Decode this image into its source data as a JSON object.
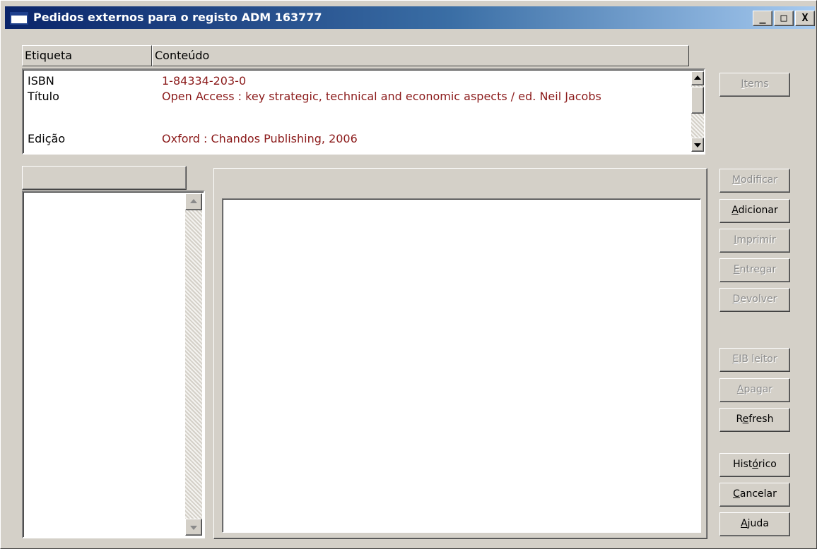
{
  "window": {
    "title": "Pedidos externos para o registo ADM 163777",
    "controls": {
      "minimize": "_",
      "maximize": "□",
      "close": "X"
    }
  },
  "record_table": {
    "columns": [
      "Etiqueta",
      "Conteúdo"
    ],
    "rows": [
      {
        "label": "ISBN",
        "value": "1-84334-203-0"
      },
      {
        "label": "Título",
        "value": "Open Access : key strategic, technical and economic aspects / ed. Neil Jacobs"
      },
      {
        "label": "Edição",
        "value": "Oxford : Chandos Publishing, 2006"
      }
    ]
  },
  "left_list": {
    "header": ""
  },
  "buttons": {
    "items": {
      "pre": "",
      "key": "I",
      "post": "tems",
      "enabled": false
    },
    "modificar": {
      "pre": "",
      "key": "M",
      "post": "odificar",
      "enabled": false
    },
    "adicionar": {
      "pre": "",
      "key": "A",
      "post": "dicionar",
      "enabled": true
    },
    "imprimir": {
      "pre": "",
      "key": "I",
      "post": "mprimir",
      "enabled": false
    },
    "entregar": {
      "pre": "",
      "key": "E",
      "post": "ntregar",
      "enabled": false
    },
    "devolver": {
      "pre": "",
      "key": "D",
      "post": "evolver",
      "enabled": false
    },
    "eib_leitor": {
      "pre": "",
      "key": "E",
      "post": "IB leitor",
      "enabled": false
    },
    "apagar": {
      "pre": "",
      "key": "A",
      "post": "pagar",
      "enabled": false
    },
    "refresh": {
      "pre": "R",
      "key": "e",
      "post": "fresh",
      "enabled": true
    },
    "historico": {
      "pre": "Hist",
      "key": "ó",
      "post": "rico",
      "enabled": true
    },
    "cancelar": {
      "pre": "",
      "key": "C",
      "post": "ancelar",
      "enabled": true
    },
    "ajuda": {
      "pre": "",
      "key": "A",
      "post": "juda",
      "enabled": true
    }
  },
  "colors": {
    "title_bar_start": "#0a246a",
    "title_bar_end": "#a6caf0",
    "field_value": "#8b1a1a",
    "dialog_face": "#d4d0c8",
    "disabled_text": "#8c8c8c"
  }
}
